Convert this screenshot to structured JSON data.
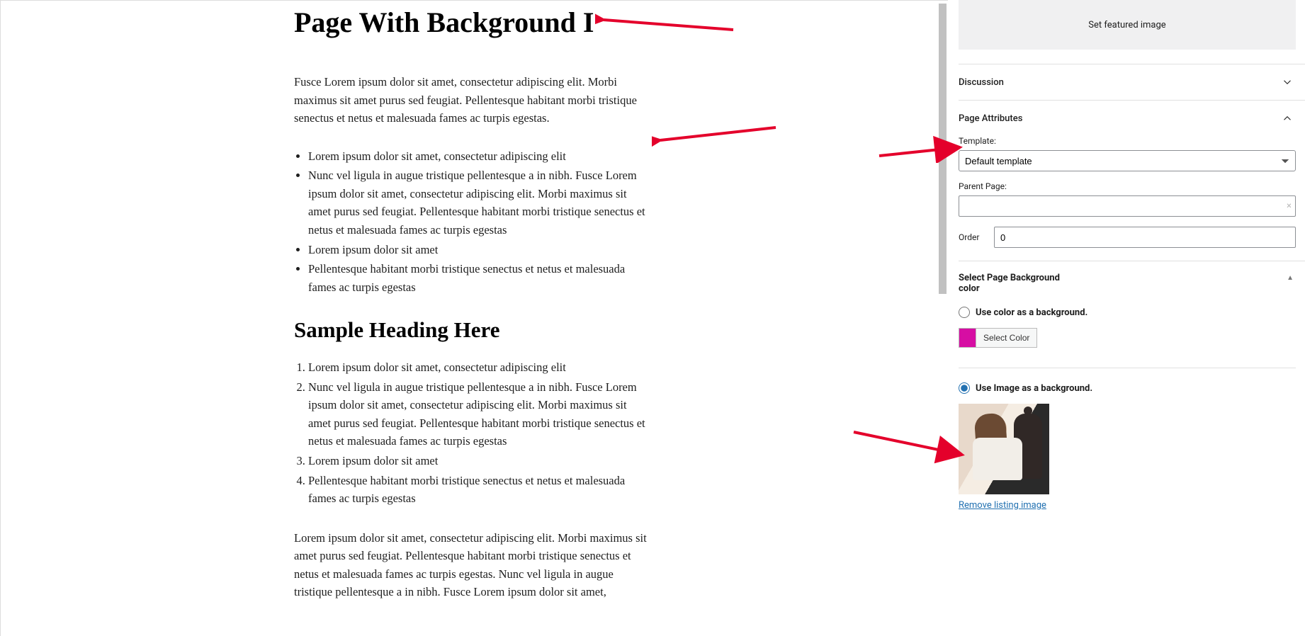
{
  "editor": {
    "title": "Page With Background I",
    "para1": "Fusce Lorem ipsum dolor sit amet, consectetur adipiscing elit. Morbi maximus sit amet purus sed feugiat. Pellentesque habitant morbi tristique senectus et netus et malesuada fames ac turpis egestas.",
    "ul": [
      "Lorem ipsum dolor sit amet, consectetur adipiscing elit",
      "Nunc vel ligula in augue tristique pellentesque a in nibh. Fusce Lorem ipsum dolor sit amet, consectetur adipiscing elit. Morbi maximus sit amet purus sed feugiat. Pellentesque habitant morbi tristique senectus et netus et malesuada fames ac turpis egestas",
      "Lorem ipsum dolor sit amet",
      "Pellentesque habitant morbi tristique senectus et netus et malesuada fames ac turpis egestas"
    ],
    "h2": "Sample Heading Here",
    "ol": [
      "Lorem ipsum dolor sit amet, consectetur adipiscing elit",
      "Nunc vel ligula in augue tristique pellentesque a in nibh. Fusce Lorem ipsum dolor sit amet, consectetur adipiscing elit. Morbi maximus sit amet purus sed feugiat. Pellentesque habitant morbi tristique senectus et netus et malesuada fames ac turpis egestas",
      "Lorem ipsum dolor sit amet",
      "Pellentesque habitant morbi tristique senectus et netus et malesuada fames ac turpis egestas"
    ],
    "para2": "Lorem ipsum dolor sit amet, consectetur adipiscing elit. Morbi maximus sit amet purus sed feugiat. Pellentesque habitant morbi tristique senectus et netus et malesuada fames ac turpis egestas. Nunc vel ligula in augue tristique pellentesque a in nibh. Fusce Lorem ipsum dolor sit amet,"
  },
  "sidebar": {
    "featured_label": "Set featured image",
    "discussion_label": "Discussion",
    "page_attributes_label": "Page Attributes",
    "template_label": "Template:",
    "template_value": "Default template",
    "parent_label": "Parent Page:",
    "parent_value": "",
    "order_label": "Order",
    "order_value": "0",
    "bg_panel_label": "Select Page Background color",
    "radio_color_label": "Use color as a background.",
    "select_color_btn": "Select Color",
    "radio_image_label": "Use Image as a background.",
    "remove_image_label": "Remove listing image",
    "swatch_color": "#d60ea3"
  }
}
